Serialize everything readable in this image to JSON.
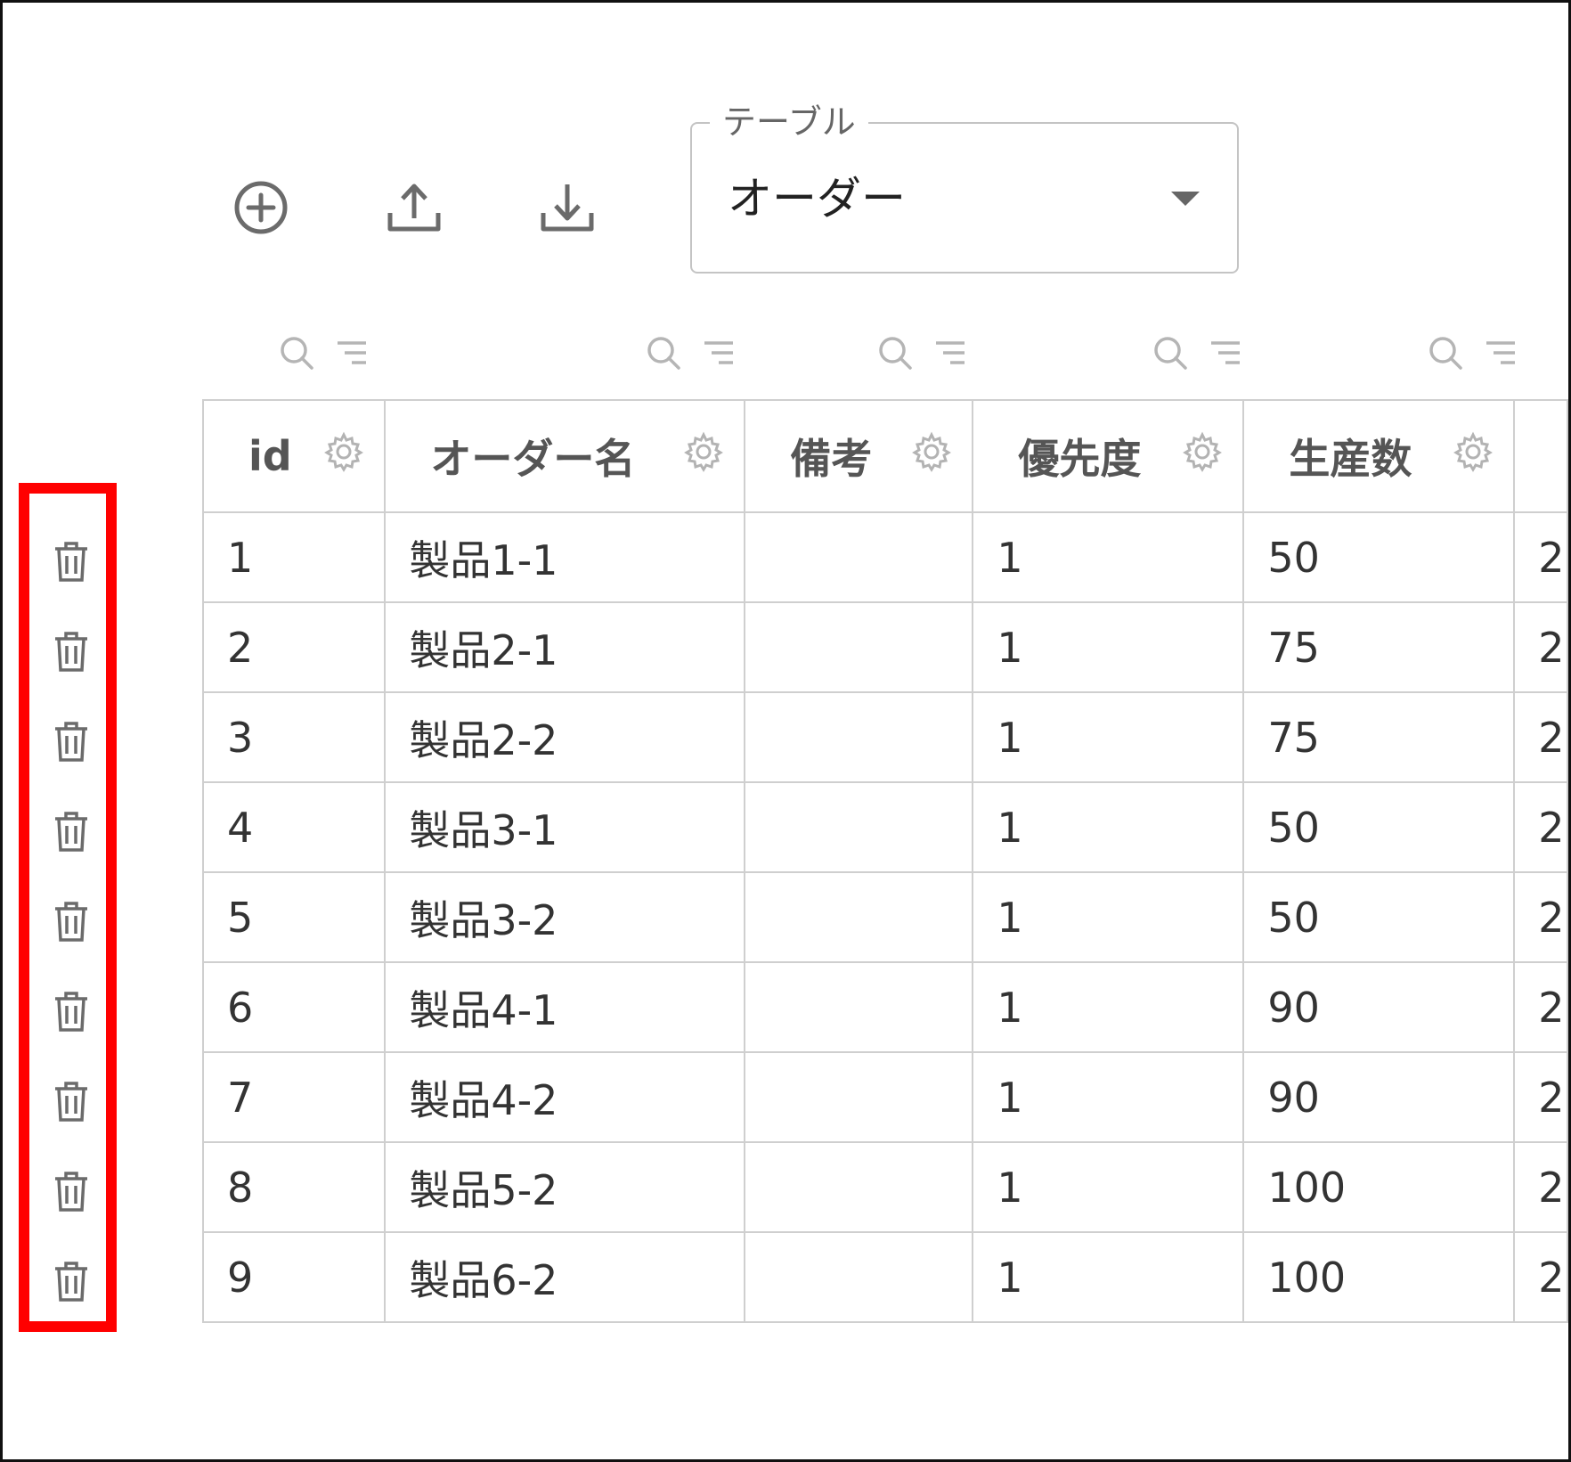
{
  "toolbar": {
    "icons": [
      "add-circle-icon",
      "upload-icon",
      "download-icon"
    ]
  },
  "table_select": {
    "label": "テーブル",
    "value": "オーダー"
  },
  "grid": {
    "columns": [
      {
        "label": "id"
      },
      {
        "label": "オーダー名"
      },
      {
        "label": "備考"
      },
      {
        "label": "優先度"
      },
      {
        "label": "生産数"
      }
    ],
    "rows": [
      {
        "id": "1",
        "name": "製品1-1",
        "note": "",
        "priority": "1",
        "qty": "50",
        "partial": "2"
      },
      {
        "id": "2",
        "name": "製品2-1",
        "note": "",
        "priority": "1",
        "qty": "75",
        "partial": "2"
      },
      {
        "id": "3",
        "name": "製品2-2",
        "note": "",
        "priority": "1",
        "qty": "75",
        "partial": "2"
      },
      {
        "id": "4",
        "name": "製品3-1",
        "note": "",
        "priority": "1",
        "qty": "50",
        "partial": "2"
      },
      {
        "id": "5",
        "name": "製品3-2",
        "note": "",
        "priority": "1",
        "qty": "50",
        "partial": "2"
      },
      {
        "id": "6",
        "name": "製品4-1",
        "note": "",
        "priority": "1",
        "qty": "90",
        "partial": "2"
      },
      {
        "id": "7",
        "name": "製品4-2",
        "note": "",
        "priority": "1",
        "qty": "90",
        "partial": "2"
      },
      {
        "id": "8",
        "name": "製品5-2",
        "note": "",
        "priority": "1",
        "qty": "100",
        "partial": "2"
      },
      {
        "id": "9",
        "name": "製品6-2",
        "note": "",
        "priority": "1",
        "qty": "100",
        "partial": "2"
      }
    ]
  },
  "colors": {
    "highlight": "#ff0000",
    "border": "#cfcfcf",
    "icon": "#777777"
  }
}
